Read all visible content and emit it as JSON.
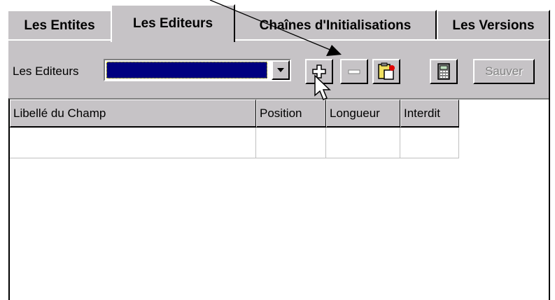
{
  "tabs": [
    {
      "label": "Les Entites",
      "active": false
    },
    {
      "label": "Les Editeurs",
      "active": true
    },
    {
      "label": "Chaînes d'Initialisations",
      "active": false
    },
    {
      "label": "Les Versions",
      "active": false
    }
  ],
  "toolbar": {
    "editors_label": "Les Editeurs",
    "combo_value": "",
    "add_icon": "plus-icon",
    "remove_icon": "minus-icon",
    "paste_icon": "clipboard-icon",
    "calc_icon": "calculator-icon",
    "save_label": "Sauver",
    "save_enabled": false
  },
  "grid": {
    "columns": [
      "Libellé du Champ",
      "Position",
      "Longueur",
      "Interdit"
    ],
    "rows": [
      [
        "",
        "",
        "",
        ""
      ]
    ]
  },
  "colors": {
    "face": "#c6c3c6",
    "selection": "#000080"
  }
}
